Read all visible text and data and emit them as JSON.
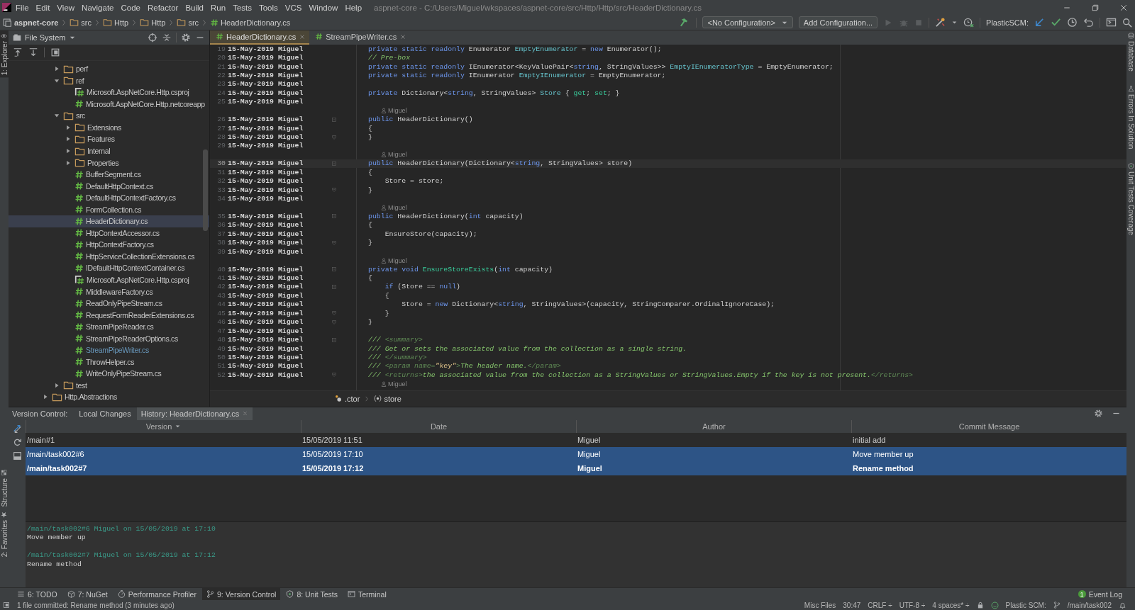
{
  "menu_bar": {
    "items": [
      "File",
      "Edit",
      "View",
      "Navigate",
      "Code",
      "Refactor",
      "Build",
      "Run",
      "Tests",
      "Tools",
      "VCS",
      "Window",
      "Help"
    ],
    "title": "aspnet-core - C:/Users/Miguel/wkspaces/aspnet-core/src/Http/Http/src/HeaderDictionary.cs"
  },
  "navigation_bar": {
    "breadcrumbs": [
      {
        "label": "aspnet-core",
        "kind": "project"
      },
      {
        "label": "src",
        "kind": "folder"
      },
      {
        "label": "Http",
        "kind": "folder"
      },
      {
        "label": "Http",
        "kind": "folder"
      },
      {
        "label": "src",
        "kind": "folder"
      },
      {
        "label": "HeaderDictionary.cs",
        "kind": "file"
      }
    ],
    "run_configuration": "<No Configuration>",
    "add_configuration": "Add Configuration...",
    "vcs_label": "PlasticSCM:"
  },
  "left_stripe": {
    "top": [
      {
        "label": "1: Explorer",
        "selected": true
      }
    ],
    "bottom": [
      {
        "label": "Structure",
        "selected": false
      },
      {
        "label": "2: Favorites",
        "selected": false
      }
    ]
  },
  "right_stripe": [
    "Database",
    "Errors In Solution",
    "Unit Tests Coverage"
  ],
  "explorer": {
    "view": "File System",
    "tree": [
      {
        "children": [
          {
            "label": "perf",
            "kind": "folder",
            "expanded": false,
            "selected": false,
            "modified": false
          },
          {
            "label": "ref",
            "kind": "folder",
            "expanded": true,
            "selected": false,
            "modified": false,
            "children": [
              {
                "label": "Microsoft.AspNetCore.Http.csproj",
                "kind": "csproj",
                "selected": false,
                "modified": false
              },
              {
                "label": "Microsoft.AspNetCore.Http.netcoreapp",
                "kind": "cs",
                "selected": false,
                "modified": false
              }
            ]
          },
          {
            "label": "src",
            "kind": "folder",
            "expanded": true,
            "selected": false,
            "modified": false,
            "children": [
              {
                "label": "Extensions",
                "kind": "folder",
                "expanded": false,
                "selected": false,
                "modified": false
              },
              {
                "label": "Features",
                "kind": "folder",
                "expanded": false,
                "selected": false,
                "modified": false
              },
              {
                "label": "Internal",
                "kind": "folder",
                "expanded": false,
                "selected": false,
                "modified": false
              },
              {
                "label": "Properties",
                "kind": "folder",
                "expanded": false,
                "selected": false,
                "modified": false
              },
              {
                "label": "BufferSegment.cs",
                "kind": "cs",
                "selected": false,
                "modified": false
              },
              {
                "label": "DefaultHttpContext.cs",
                "kind": "cs",
                "selected": false,
                "modified": false
              },
              {
                "label": "DefaultHttpContextFactory.cs",
                "kind": "cs",
                "selected": false,
                "modified": false
              },
              {
                "label": "FormCollection.cs",
                "kind": "cs",
                "selected": false,
                "modified": false
              },
              {
                "label": "HeaderDictionary.cs",
                "kind": "cs",
                "selected": true,
                "modified": false
              },
              {
                "label": "HttpContextAccessor.cs",
                "kind": "cs",
                "selected": false,
                "modified": false
              },
              {
                "label": "HttpContextFactory.cs",
                "kind": "cs",
                "selected": false,
                "modified": false
              },
              {
                "label": "HttpServiceCollectionExtensions.cs",
                "kind": "cs",
                "selected": false,
                "modified": false
              },
              {
                "label": "IDefaultHttpContextContainer.cs",
                "kind": "cs",
                "selected": false,
                "modified": false
              },
              {
                "label": "Microsoft.AspNetCore.Http.csproj",
                "kind": "csproj",
                "selected": false,
                "modified": false
              },
              {
                "label": "MiddlewareFactory.cs",
                "kind": "cs",
                "selected": false,
                "modified": false
              },
              {
                "label": "ReadOnlyPipeStream.cs",
                "kind": "cs",
                "selected": false,
                "modified": false
              },
              {
                "label": "RequestFormReaderExtensions.cs",
                "kind": "cs",
                "selected": false,
                "modified": false
              },
              {
                "label": "StreamPipeReader.cs",
                "kind": "cs",
                "selected": false,
                "modified": false
              },
              {
                "label": "StreamPipeReaderOptions.cs",
                "kind": "cs",
                "selected": false,
                "modified": false
              },
              {
                "label": "StreamPipeWriter.cs",
                "kind": "cs",
                "selected": false,
                "modified": true
              },
              {
                "label": "ThrowHelper.cs",
                "kind": "cs",
                "selected": false,
                "modified": false
              },
              {
                "label": "WriteOnlyPipeStream.cs",
                "kind": "cs",
                "selected": false,
                "modified": false
              }
            ]
          },
          {
            "label": "test",
            "kind": "folder",
            "expanded": false,
            "selected": false,
            "modified": false
          }
        ]
      },
      {
        "label": "Http.Abstractions",
        "kind": "folder",
        "expanded": false,
        "selected": false,
        "modified": false
      }
    ]
  },
  "editor": {
    "tabs": [
      {
        "label": "HeaderDictionary.cs",
        "selected": true
      },
      {
        "label": "StreamPipeWriter.cs",
        "selected": false
      }
    ],
    "lines": [
      {
        "kind": "line",
        "number": "19",
        "annotation": "15-May-2019 Miguel",
        "current": false,
        "code": [
          {
            "kind": "kw",
            "text": "private static readonly "
          },
          {
            "kind": "pl",
            "text": "Enumerator "
          },
          {
            "kind": "fld",
            "text": "EmptyEnumerator"
          },
          {
            "kind": "pl",
            "text": " = "
          },
          {
            "kind": "kw",
            "text": "new "
          },
          {
            "kind": "pl",
            "text": "Enumerator();"
          }
        ]
      },
      {
        "kind": "line",
        "number": "20",
        "annotation": "15-May-2019 Miguel",
        "current": false,
        "code": [
          {
            "kind": "cm",
            "text": "// Pre-box"
          }
        ]
      },
      {
        "kind": "line",
        "number": "21",
        "annotation": "15-May-2019 Miguel",
        "current": false,
        "code": [
          {
            "kind": "kw",
            "text": "private static readonly "
          },
          {
            "kind": "pl",
            "text": "IEnumerator<KeyValuePair<"
          },
          {
            "kind": "kw",
            "text": "string"
          },
          {
            "kind": "pl",
            "text": ", StringValues>> "
          },
          {
            "kind": "fld",
            "text": "EmptyIEnumeratorType"
          },
          {
            "kind": "pl",
            "text": " = EmptyEnumerator;"
          }
        ]
      },
      {
        "kind": "line",
        "number": "22",
        "annotation": "15-May-2019 Miguel",
        "current": false,
        "code": [
          {
            "kind": "kw",
            "text": "private static readonly "
          },
          {
            "kind": "pl",
            "text": "IEnumerator "
          },
          {
            "kind": "fld",
            "text": "EmptyIEnumerator"
          },
          {
            "kind": "pl",
            "text": " = EmptyEnumerator;"
          }
        ]
      },
      {
        "kind": "line",
        "number": "23",
        "annotation": "15-May-2019 Miguel",
        "current": false
      },
      {
        "kind": "line",
        "number": "24",
        "annotation": "15-May-2019 Miguel",
        "current": false,
        "code": [
          {
            "kind": "kw",
            "text": "private "
          },
          {
            "kind": "pl",
            "text": "Dictionary<"
          },
          {
            "kind": "kw",
            "text": "string"
          },
          {
            "kind": "pl",
            "text": ", StringValues> "
          },
          {
            "kind": "fld",
            "text": "Store"
          },
          {
            "kind": "pl",
            "text": " { "
          },
          {
            "kind": "mth",
            "text": "get"
          },
          {
            "kind": "pl",
            "text": "; "
          },
          {
            "kind": "mth",
            "text": "set"
          },
          {
            "kind": "pl",
            "text": "; }"
          }
        ]
      },
      {
        "kind": "line",
        "number": "25",
        "annotation": "15-May-2019 Miguel",
        "current": false
      },
      {
        "kind": "author",
        "text": "Miguel"
      },
      {
        "kind": "line",
        "number": "26",
        "annotation": "15-May-2019 Miguel",
        "current": false,
        "fold": true,
        "code": [
          {
            "kind": "kw",
            "text": "public "
          },
          {
            "kind": "pl",
            "text": "HeaderDictionary()"
          }
        ]
      },
      {
        "kind": "line",
        "number": "27",
        "annotation": "15-May-2019 Miguel",
        "current": false,
        "code": [
          {
            "kind": "pl",
            "text": "{"
          }
        ]
      },
      {
        "kind": "line",
        "number": "28",
        "annotation": "15-May-2019 Miguel",
        "current": false,
        "fold_end": true,
        "code": [
          {
            "kind": "pl",
            "text": "}"
          }
        ]
      },
      {
        "kind": "line",
        "number": "29",
        "annotation": "15-May-2019 Miguel",
        "current": false
      },
      {
        "kind": "author",
        "text": "Miguel"
      },
      {
        "kind": "line",
        "number": "30",
        "annotation": "15-May-2019 Miguel",
        "current": true,
        "fold": true,
        "code": [
          {
            "kind": "kw",
            "text": "public "
          },
          {
            "kind": "pl",
            "text": "HeaderDictionary(Dictionary<"
          },
          {
            "kind": "kw",
            "text": "string"
          },
          {
            "kind": "pl",
            "text": ", StringValues> store)"
          }
        ]
      },
      {
        "kind": "line",
        "number": "31",
        "annotation": "15-May-2019 Miguel",
        "current": false,
        "code": [
          {
            "kind": "pl",
            "text": "{"
          }
        ]
      },
      {
        "kind": "line",
        "number": "32",
        "annotation": "15-May-2019 Miguel",
        "current": false,
        "code": [
          {
            "kind": "pl",
            "text": "    Store = store;"
          }
        ]
      },
      {
        "kind": "line",
        "number": "33",
        "annotation": "15-May-2019 Miguel",
        "current": false,
        "fold_end": true,
        "code": [
          {
            "kind": "pl",
            "text": "}"
          }
        ]
      },
      {
        "kind": "line",
        "number": "34",
        "annotation": "15-May-2019 Miguel",
        "current": false
      },
      {
        "kind": "author",
        "text": "Miguel"
      },
      {
        "kind": "line",
        "number": "35",
        "annotation": "15-May-2019 Miguel",
        "current": false,
        "fold": true,
        "code": [
          {
            "kind": "kw",
            "text": "public "
          },
          {
            "kind": "pl",
            "text": "HeaderDictionary("
          },
          {
            "kind": "kw",
            "text": "int"
          },
          {
            "kind": "pl",
            "text": " capacity)"
          }
        ]
      },
      {
        "kind": "line",
        "number": "36",
        "annotation": "15-May-2019 Miguel",
        "current": false,
        "code": [
          {
            "kind": "pl",
            "text": "{"
          }
        ]
      },
      {
        "kind": "line",
        "number": "37",
        "annotation": "15-May-2019 Miguel",
        "current": false,
        "code": [
          {
            "kind": "pl",
            "text": "    EnsureStore(capacity);"
          }
        ]
      },
      {
        "kind": "line",
        "number": "38",
        "annotation": "15-May-2019 Miguel",
        "current": false,
        "fold_end": true,
        "code": [
          {
            "kind": "pl",
            "text": "}"
          }
        ]
      },
      {
        "kind": "line",
        "number": "39",
        "annotation": "15-May-2019 Miguel",
        "current": false
      },
      {
        "kind": "author",
        "text": "Miguel"
      },
      {
        "kind": "line",
        "number": "40",
        "annotation": "15-May-2019 Miguel",
        "current": false,
        "fold": true,
        "code": [
          {
            "kind": "kw",
            "text": "private void "
          },
          {
            "kind": "mth",
            "text": "EnsureStoreExists"
          },
          {
            "kind": "pl",
            "text": "("
          },
          {
            "kind": "kw",
            "text": "int"
          },
          {
            "kind": "pl",
            "text": " capacity)"
          }
        ]
      },
      {
        "kind": "line",
        "number": "41",
        "annotation": "15-May-2019 Miguel",
        "current": false,
        "code": [
          {
            "kind": "pl",
            "text": "{"
          }
        ]
      },
      {
        "kind": "line",
        "number": "42",
        "annotation": "15-May-2019 Miguel",
        "current": false,
        "fold": true,
        "code": [
          {
            "kind": "kw",
            "text": "    if"
          },
          {
            "kind": "pl",
            "text": " (Store == "
          },
          {
            "kind": "kw",
            "text": "null"
          },
          {
            "kind": "pl",
            "text": ")"
          }
        ]
      },
      {
        "kind": "line",
        "number": "43",
        "annotation": "15-May-2019 Miguel",
        "current": false,
        "code": [
          {
            "kind": "pl",
            "text": "    {"
          }
        ]
      },
      {
        "kind": "line",
        "number": "44",
        "annotation": "15-May-2019 Miguel",
        "current": false,
        "code": [
          {
            "kind": "pl",
            "text": "        Store = "
          },
          {
            "kind": "kw",
            "text": "new"
          },
          {
            "kind": "pl",
            "text": " Dictionary<"
          },
          {
            "kind": "kw",
            "text": "string"
          },
          {
            "kind": "pl",
            "text": ", StringValues>(capacity, StringComparer.OrdinalIgnoreCase);"
          }
        ]
      },
      {
        "kind": "line",
        "number": "45",
        "annotation": "15-May-2019 Miguel",
        "current": false,
        "fold_end": true,
        "code": [
          {
            "kind": "pl",
            "text": "    }"
          }
        ]
      },
      {
        "kind": "line",
        "number": "46",
        "annotation": "15-May-2019 Miguel",
        "current": false,
        "fold_end": true,
        "code": [
          {
            "kind": "pl",
            "text": "}"
          }
        ]
      },
      {
        "kind": "line",
        "number": "47",
        "annotation": "15-May-2019 Miguel",
        "current": false
      },
      {
        "kind": "line",
        "number": "48",
        "annotation": "15-May-2019 Miguel",
        "current": false,
        "fold": true,
        "code": [
          {
            "kind": "cm",
            "text": "/// "
          },
          {
            "kind": "dt",
            "text": "<summary>"
          }
        ]
      },
      {
        "kind": "line",
        "number": "49",
        "annotation": "15-May-2019 Miguel",
        "current": false,
        "code": [
          {
            "kind": "cm",
            "text": "/// Get or sets the associated value from the collection as a single string."
          }
        ]
      },
      {
        "kind": "line",
        "number": "50",
        "annotation": "15-May-2019 Miguel",
        "current": false,
        "code": [
          {
            "kind": "cm",
            "text": "/// "
          },
          {
            "kind": "dt",
            "text": "</summary>"
          }
        ]
      },
      {
        "kind": "line",
        "number": "51",
        "annotation": "15-May-2019 Miguel",
        "current": false,
        "code": [
          {
            "kind": "cm",
            "text": "/// "
          },
          {
            "kind": "dt",
            "text": "<param name="
          },
          {
            "kind": "str",
            "text": "\"key\""
          },
          {
            "kind": "dt",
            "text": ">"
          },
          {
            "kind": "cm",
            "text": "The header name."
          },
          {
            "kind": "dt",
            "text": "</param>"
          }
        ]
      },
      {
        "kind": "line",
        "number": "52",
        "annotation": "15-May-2019 Miguel",
        "current": false,
        "fold_end": true,
        "code": [
          {
            "kind": "cm",
            "text": "/// "
          },
          {
            "kind": "dt",
            "text": "<returns>"
          },
          {
            "kind": "cm",
            "text": "the associated value from the collection as a StringValues or StringValues.Empty if the key is not present."
          },
          {
            "kind": "dt",
            "text": "</returns>"
          }
        ]
      },
      {
        "kind": "author",
        "text": "Miguel"
      }
    ],
    "breadcrumbs": [
      ".ctor",
      "store"
    ]
  },
  "version_control": {
    "title": "Version Control:",
    "tabs": [
      {
        "label": "Local Changes",
        "selected": false,
        "closable": false
      },
      {
        "label": "History: HeaderDictionary.cs",
        "selected": true,
        "closable": true
      }
    ],
    "columns": [
      {
        "label": "Version",
        "sorted": true
      },
      {
        "label": "Date",
        "sorted": false
      },
      {
        "label": "Author",
        "sorted": false
      },
      {
        "label": "Commit Message",
        "sorted": false
      }
    ],
    "rows": [
      {
        "cells": [
          "/main#1",
          "15/05/2019 11:51",
          "Miguel",
          "initial add"
        ],
        "selected": false,
        "current": false
      },
      {
        "cells": [
          "/main/task002#6",
          "15/05/2019 17:10",
          "Miguel",
          "Move member up"
        ],
        "selected": true,
        "current": false
      },
      {
        "cells": [
          "/main/task002#7",
          "15/05/2019 17:12",
          "Miguel",
          "Rename method"
        ],
        "selected": true,
        "current": true
      }
    ],
    "details": [
      {
        "header": "/main/task002#6 Miguel on 15/05/2019 at 17:10",
        "message": "Move member up"
      },
      {
        "header": "/main/task002#7 Miguel on 15/05/2019 at 17:12",
        "message": "Rename method"
      }
    ]
  },
  "tool_windows": [
    {
      "label": "6: TODO",
      "selected": false
    },
    {
      "label": "7: NuGet",
      "selected": false
    },
    {
      "label": "Performance Profiler",
      "selected": false
    },
    {
      "label": "9: Version Control",
      "selected": true
    },
    {
      "label": "8: Unit Tests",
      "selected": false
    },
    {
      "label": "Terminal",
      "selected": false
    }
  ],
  "event_log": {
    "label": "Event Log",
    "badge": "1"
  },
  "status_bar": {
    "message": "1 file committed: Rename method (3 minutes ago)",
    "items": [
      "Misc Files",
      "30:47",
      "CRLF ÷",
      "UTF-8 ÷",
      "4 spaces* ÷"
    ],
    "vcs_label": "Plastic SCM:",
    "branch": "/main/task002"
  }
}
